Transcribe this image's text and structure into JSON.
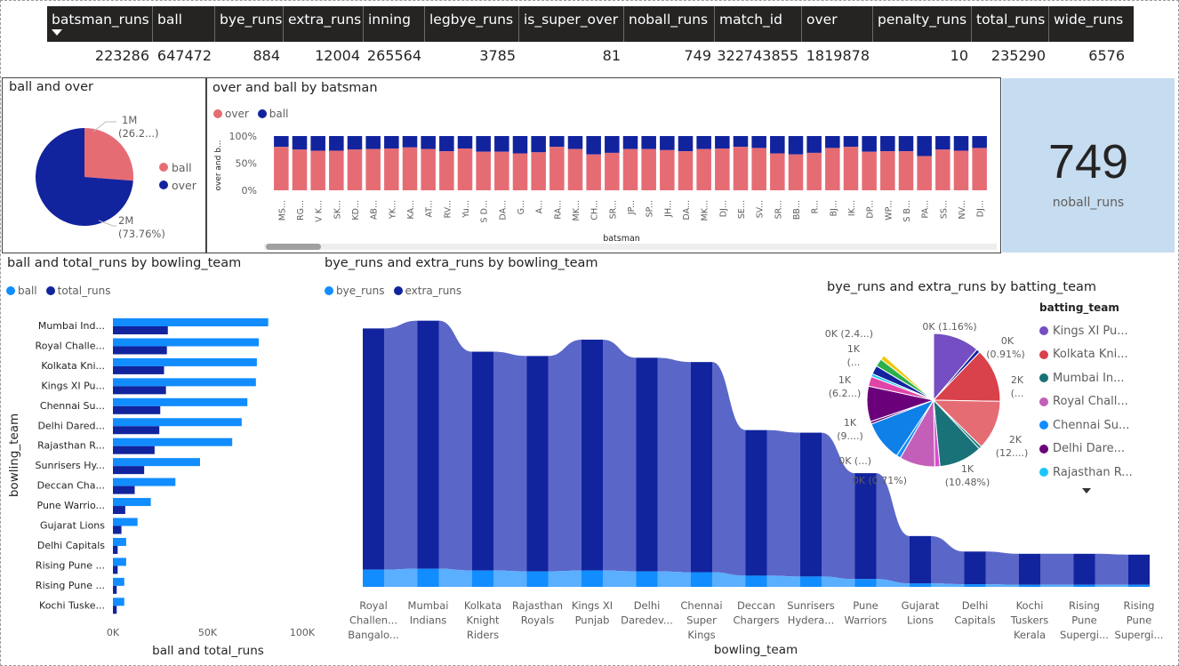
{
  "table": {
    "columns": [
      "batsman_runs",
      "ball",
      "bye_runs",
      "extra_runs",
      "inning",
      "legbye_runs",
      "is_super_over",
      "noball_runs",
      "match_id",
      "over",
      "penalty_runs",
      "total_runs",
      "wide_runs"
    ],
    "values": [
      "223286",
      "647472",
      "884",
      "12004",
      "265564",
      "3785",
      "81",
      "749",
      "322743855",
      "1819878",
      "10",
      "235290",
      "6576"
    ]
  },
  "colors": {
    "pink": "#e66c74",
    "navy": "#12239e",
    "blue": "#118dff",
    "mid": "#5a67c8",
    "light": "#5aafff",
    "cardBg": "#c6dcf0"
  },
  "card": {
    "value": "749",
    "label": "noball_runs"
  },
  "chart_data": [
    {
      "type": "pie",
      "title": "ball and over",
      "legend": [
        "ball",
        "over"
      ],
      "slices": [
        {
          "name": "ball",
          "value": 0.2624,
          "label": "1M",
          "pct": "(26.2...)"
        },
        {
          "name": "over",
          "value": 0.7376,
          "label": "2M",
          "pct": "(73.76%)"
        }
      ]
    },
    {
      "type": "bar",
      "stacked": "100%",
      "title": "over and ball by batsman",
      "xlabel": "batsman",
      "ylabel": "over and b...",
      "ticks": [
        "0%",
        "50%",
        "100%"
      ],
      "series_names": [
        "over",
        "ball"
      ],
      "categories": [
        "MS...",
        "RG...",
        "V K...",
        "SK...",
        "KD...",
        "AB...",
        "YK...",
        "KA...",
        "AT...",
        "RV...",
        "Yu...",
        "S D...",
        "DA...",
        "G...",
        "A...",
        "RA...",
        "MK...",
        "CH...",
        "SR...",
        "JP...",
        "SP...",
        "JH...",
        "DA...",
        "MK...",
        "DJ...",
        "SE...",
        "SV...",
        "SR...",
        "BB...",
        "R...",
        "BJ...",
        "IK...",
        "DP...",
        "WP...",
        "S B...",
        "PA...",
        "SS...",
        "NV...",
        "DJ..."
      ],
      "over_share": [
        0.8,
        0.75,
        0.73,
        0.73,
        0.75,
        0.76,
        0.77,
        0.79,
        0.76,
        0.72,
        0.77,
        0.71,
        0.71,
        0.68,
        0.7,
        0.8,
        0.76,
        0.66,
        0.69,
        0.76,
        0.76,
        0.74,
        0.72,
        0.76,
        0.77,
        0.8,
        0.78,
        0.68,
        0.66,
        0.69,
        0.78,
        0.8,
        0.71,
        0.72,
        0.72,
        0.63,
        0.75,
        0.73,
        0.78
      ]
    },
    {
      "type": "bar",
      "orientation": "horizontal",
      "title": "ball and total_runs by bowling_team",
      "xlabel": "ball and total_runs",
      "ylabel": "bowling_team",
      "xticks": [
        "0K",
        "50K",
        "100K"
      ],
      "xlim": [
        0,
        100000
      ],
      "categories": [
        "Mumbai Ind...",
        "Royal Challe...",
        "Kolkata Kni...",
        "Kings XI Pu...",
        "Chennai Su...",
        "Delhi Dared...",
        "Rajasthan R...",
        "Sunrisers Hy...",
        "Deccan Cha...",
        "Pune Warrio...",
        "Gujarat Lions",
        "Delhi Capitals",
        "Rising Pune ...",
        "Rising Pune ...",
        "Kochi Tuske..."
      ],
      "series": [
        {
          "name": "ball",
          "values": [
            82000,
            77000,
            76000,
            75500,
            71000,
            68000,
            63000,
            46000,
            33000,
            20000,
            13000,
            7000,
            7000,
            6000,
            6000
          ]
        },
        {
          "name": "total_runs",
          "values": [
            29000,
            28500,
            27000,
            28000,
            25000,
            24500,
            22000,
            16500,
            11500,
            6500,
            4500,
            2500,
            2500,
            2000,
            2000
          ]
        }
      ]
    },
    {
      "type": "area",
      "subtype": "ribbon",
      "title": "bye_runs and extra_runs by bowling_team",
      "xlabel": "bowling_team",
      "series_names": [
        "bye_runs",
        "extra_runs"
      ],
      "categories": [
        [
          "Royal",
          "Challen...",
          "Bangalo..."
        ],
        [
          "Mumbai",
          "Indians"
        ],
        [
          "Kolkata",
          "Knight",
          "Riders"
        ],
        [
          "Rajasthan",
          "Royals"
        ],
        [
          "Kings XI",
          "Punjab"
        ],
        [
          "Delhi",
          "Daredev..."
        ],
        [
          "Chennai",
          "Super",
          "Kings"
        ],
        [
          "Deccan",
          "Chargers"
        ],
        [
          "Sunrisers",
          "Hydera..."
        ],
        [
          "Pune",
          "Warriors"
        ],
        [
          "Gujarat",
          "Lions"
        ],
        [
          "Delhi",
          "Capitals"
        ],
        [
          "Kochi",
          "Tuskers",
          "Kerala"
        ],
        [
          "Rising",
          "Pune",
          "Supergi..."
        ],
        [
          "Rising",
          "Pune",
          "Supergi..."
        ]
      ],
      "extra_runs": [
        1400,
        1440,
        1270,
        1250,
        1340,
        1240,
        1220,
        845,
        835,
        615,
        275,
        190,
        180,
        180,
        175
      ],
      "bye_runs": [
        100,
        105,
        95,
        90,
        95,
        90,
        85,
        65,
        60,
        45,
        20,
        15,
        12,
        12,
        12
      ]
    },
    {
      "type": "pie",
      "title": "bye_runs and extra_runs by batting_team",
      "legend_title": "batting_team",
      "legend": [
        "Kings XI Pu...",
        "Kolkata Kni...",
        "Mumbai In...",
        "Royal Chall...",
        "Chennai Su...",
        "Delhi Dare...",
        "Rajasthan R..."
      ],
      "values": [
        0.1126,
        0.0091,
        0.1311,
        0.1201,
        0.0071,
        0.1048,
        0.0124,
        0.0861,
        0.0105,
        0.0979,
        0.0062,
        0.0857,
        0.0241,
        0.0071,
        0.0211,
        0.0191,
        0.0116
      ],
      "slice_colors": [
        "#744ec2",
        "#12239e",
        "#d9414b",
        "#e66c74",
        "#1a7b7a",
        "#197278",
        "#d64ecd",
        "#c35fb9",
        "#118dff",
        "#0e80e8",
        "#6b007b",
        "#6b007b",
        "#e044a7",
        "#1ac6ff",
        "#12239e",
        "#2bb04a",
        "#f2c80f"
      ],
      "labels": [
        {
          "text": "0K (1.16%)"
        },
        {
          "text": "0K"
        },
        {
          "text": "(0.91%)"
        },
        {
          "text": "2K"
        },
        {
          "text": "(..."
        },
        {
          "text": "2K"
        },
        {
          "text": "(12....)"
        },
        {
          "text": "1K"
        },
        {
          "text": "(10.48%)"
        },
        {
          "text": "0K (0.71%)"
        },
        {
          "text": "0K (...)"
        },
        {
          "text": "1K"
        },
        {
          "text": "(9....)"
        },
        {
          "text": "1K"
        },
        {
          "text": "(..."
        },
        {
          "text": "1K"
        },
        {
          "text": "(6.2...)"
        },
        {
          "text": "0K (2.4...)"
        }
      ]
    }
  ]
}
